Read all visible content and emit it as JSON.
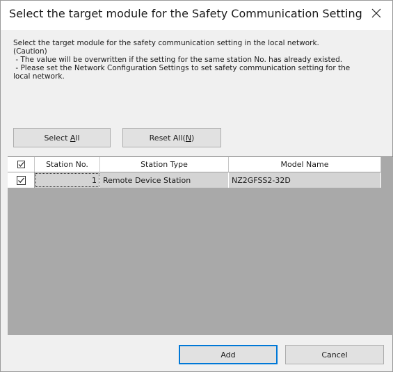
{
  "dialog": {
    "title": "Select the target module for the Safety Communication Setting",
    "close_icon": "close-icon"
  },
  "description": {
    "line1": "Select the target module for the safety communication setting in the local network.",
    "line2": "(Caution)",
    "line3": " - The value will be overwritten if the setting for the same station No. has already existed.",
    "line4": " - Please set the Network Configuration Settings to set safety communication setting for the",
    "line5": "local network."
  },
  "buttons": {
    "select_all_prefix": "Select ",
    "select_all_mnemonic": "A",
    "select_all_suffix": "ll",
    "reset_all_prefix": "Reset All(",
    "reset_all_mnemonic": "N",
    "reset_all_suffix": ")",
    "add": "Add",
    "cancel": "Cancel"
  },
  "table": {
    "header_checkbox_checked": true,
    "columns": [
      "Station No.",
      "Station Type",
      "Model Name"
    ],
    "rows": [
      {
        "checked": true,
        "station_no": "1",
        "station_type": "Remote Device Station",
        "model_name": "NZ2GFSS2-32D"
      }
    ]
  },
  "colors": {
    "accent": "#0078d7",
    "grid_background": "#a9a9a9",
    "row_background": "#d4d4d4"
  }
}
